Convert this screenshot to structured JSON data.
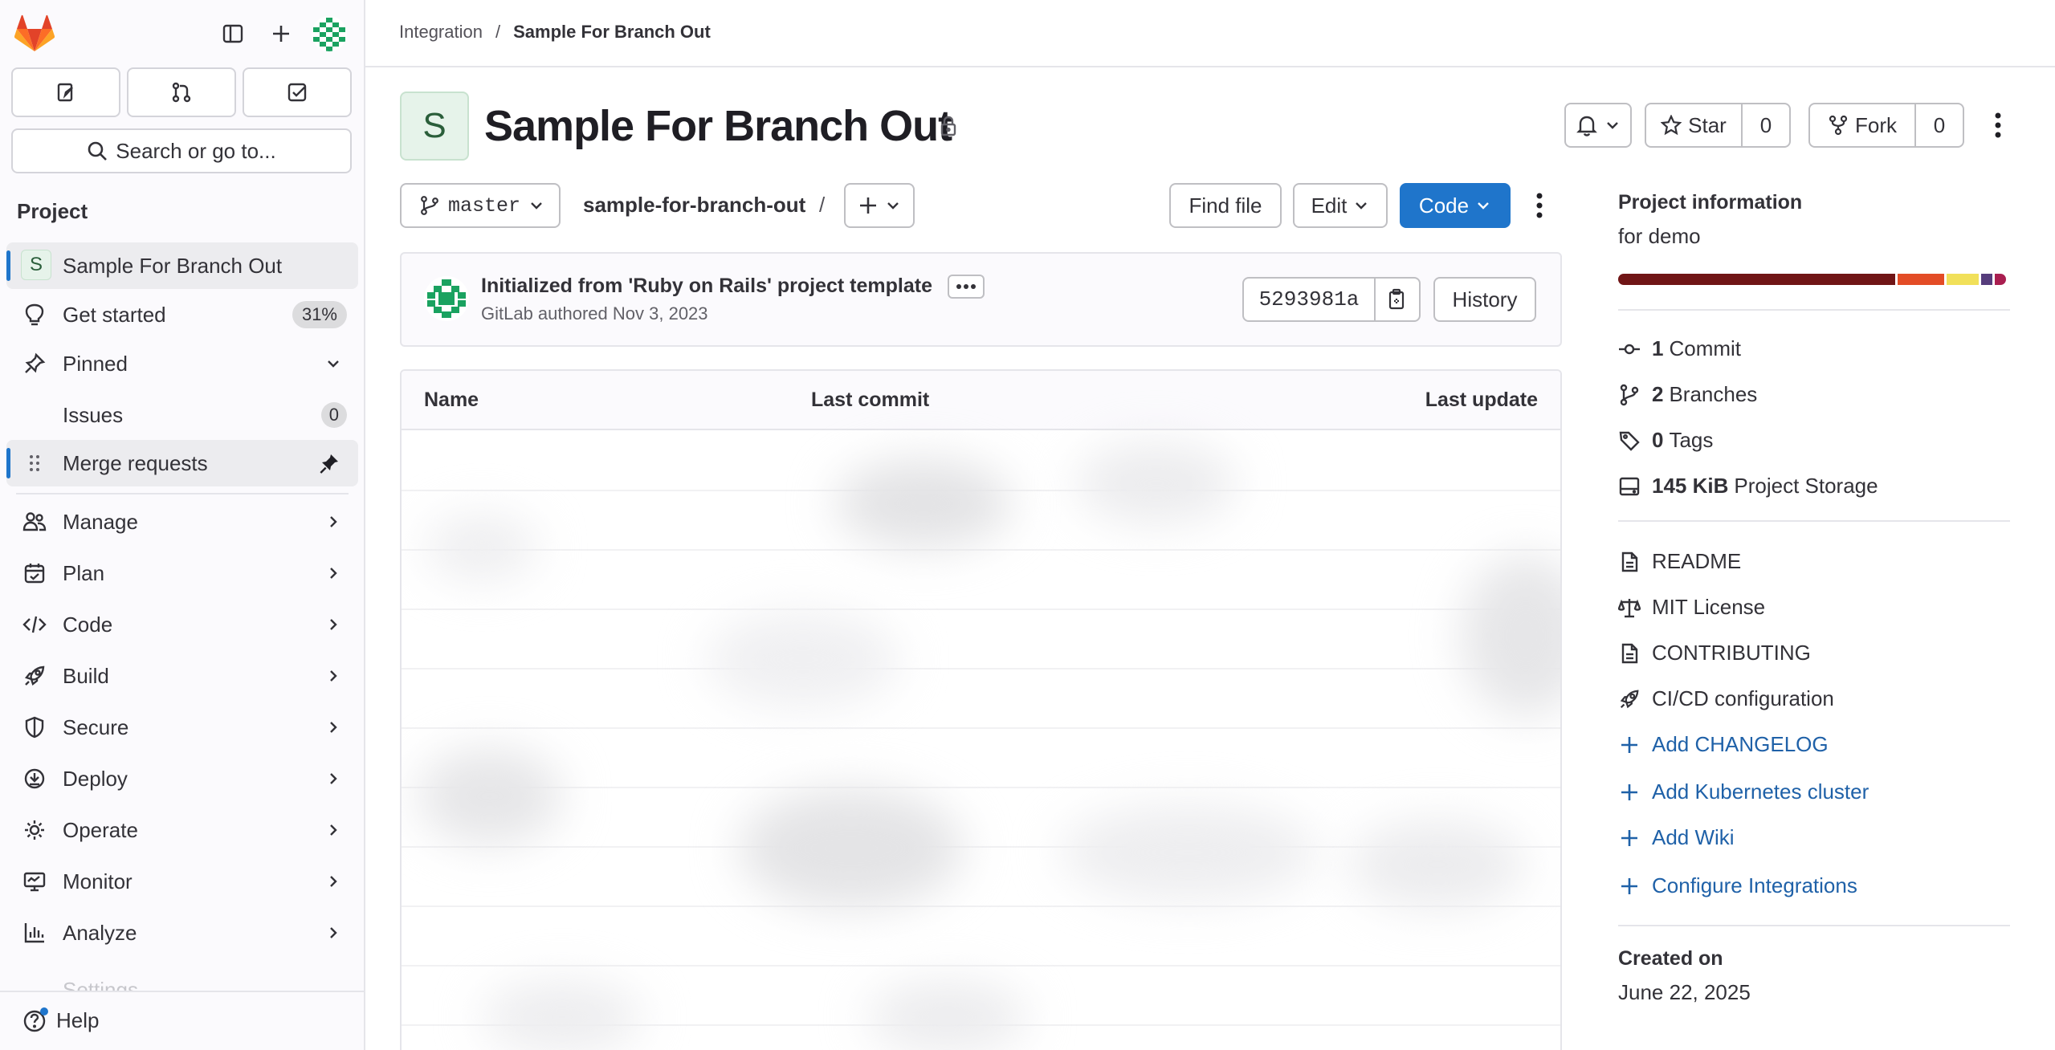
{
  "sidebar": {
    "section_title": "Project",
    "search_label": "Search or go to...",
    "project_item": {
      "avatar_letter": "S",
      "label": "Sample For Branch Out"
    },
    "get_started": {
      "label": "Get started",
      "badge": "31%"
    },
    "pinned": {
      "label": "Pinned"
    },
    "pinned_items": [
      {
        "label": "Issues",
        "count": "0"
      },
      {
        "label": "Merge requests"
      }
    ],
    "menu": [
      {
        "label": "Manage",
        "icon": "users-icon"
      },
      {
        "label": "Plan",
        "icon": "calendar-icon"
      },
      {
        "label": "Code",
        "icon": "code-icon"
      },
      {
        "label": "Build",
        "icon": "rocket-icon"
      },
      {
        "label": "Secure",
        "icon": "shield-icon"
      },
      {
        "label": "Deploy",
        "icon": "deploy-icon"
      },
      {
        "label": "Operate",
        "icon": "cloud-gear-icon"
      },
      {
        "label": "Monitor",
        "icon": "monitor-icon"
      },
      {
        "label": "Analyze",
        "icon": "chart-icon"
      }
    ],
    "faded_item": "Settings",
    "help_label": "Help"
  },
  "breadcrumb": {
    "parent": "Integration",
    "separator": "/",
    "current": "Sample For Branch Out"
  },
  "project": {
    "avatar_letter": "S",
    "title": "Sample For Branch Out",
    "star_label": "Star",
    "star_count": "0",
    "fork_label": "Fork",
    "fork_count": "0"
  },
  "repo_toolbar": {
    "branch": "master",
    "path": "sample-for-branch-out",
    "path_sep": "/",
    "find_file": "Find file",
    "edit": "Edit",
    "code": "Code"
  },
  "commit": {
    "title": "Initialized from 'Ruby on Rails' project template",
    "author_line": "GitLab authored Nov 3, 2023",
    "sha": "5293981a",
    "history": "History"
  },
  "file_table": {
    "columns": [
      "Name",
      "Last commit",
      "Last update"
    ]
  },
  "project_info": {
    "title": "Project information",
    "description": "for demo",
    "languages_colors": [
      "#701516",
      "#e34c26",
      "#f1e05a",
      "#563d7c",
      "#a91e50"
    ],
    "stats": [
      {
        "value": "1",
        "label": "Commit",
        "icon": "commit-icon"
      },
      {
        "value": "2",
        "label": "Branches",
        "icon": "branch-icon"
      },
      {
        "value": "0",
        "label": "Tags",
        "icon": "tag-icon"
      },
      {
        "value": "145 KiB",
        "label": "Project Storage",
        "icon": "storage-icon"
      }
    ],
    "files": [
      {
        "label": "README",
        "icon": "doc-icon"
      },
      {
        "label": "MIT License",
        "icon": "scale-icon"
      },
      {
        "label": "CONTRIBUTING",
        "icon": "doc-icon"
      },
      {
        "label": "CI/CD configuration",
        "icon": "rocket-icon"
      }
    ],
    "add_links": [
      {
        "label": "Add CHANGELOG"
      },
      {
        "label": "Add Kubernetes cluster"
      },
      {
        "label": "Add Wiki"
      },
      {
        "label": "Configure Integrations"
      }
    ],
    "created_label": "Created on",
    "created_value": "June 22, 2025"
  }
}
